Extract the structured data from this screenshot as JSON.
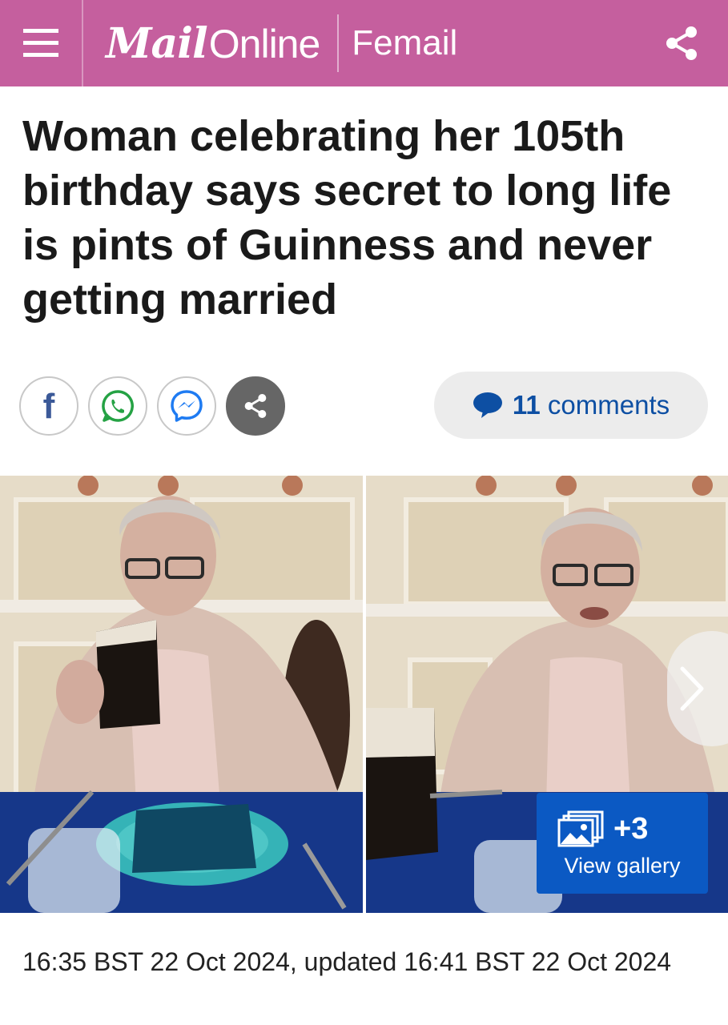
{
  "header": {
    "logo_mail": "Mail",
    "logo_online": "Online",
    "section": "Femail",
    "menu_icon": "hamburger-menu-icon",
    "share_icon": "share-icon",
    "color": "#c55f9e"
  },
  "article": {
    "headline": "Woman celebrating her 105th birthday says secret to long life is pints of Guinness and never getting married",
    "timestamp": "16:35 BST 22 Oct 2024, updated 16:41 BST 22 Oct 2024"
  },
  "social": {
    "buttons": [
      {
        "icon": "facebook-icon"
      },
      {
        "icon": "whatsapp-icon"
      },
      {
        "icon": "messenger-icon"
      },
      {
        "icon": "share-icon"
      }
    ],
    "comments_count": "11",
    "comments_label": "comments"
  },
  "gallery": {
    "count": "+3",
    "label": "View gallery",
    "next_icon": "chevron-right-icon",
    "accent": "#0b59c3"
  }
}
